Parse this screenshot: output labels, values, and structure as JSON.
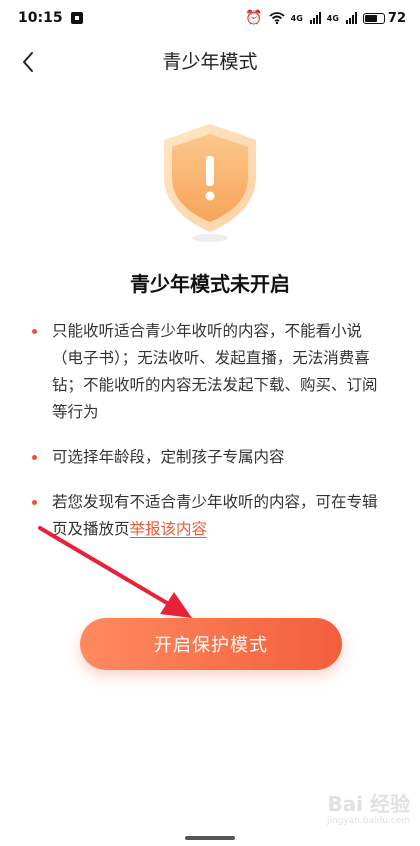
{
  "status_bar": {
    "time": "10:15",
    "battery": "72",
    "battery_level": 0.72,
    "signal_label_1": "4G",
    "signal_label_2": "4G"
  },
  "header": {
    "title": "青少年模式",
    "back_icon": "chevron-left-icon"
  },
  "main": {
    "illustration_icon": "shield-exclamation-icon",
    "status_title": "青少年模式未开启",
    "items": [
      {
        "text": "只能收听适合青少年收听的内容，不能看小说（电子书）；无法收听、发起直播，无法消费喜钻；不能收听的内容无法发起下载、购买、订阅等行为"
      },
      {
        "text": "可选择年龄段，定制孩子专属内容"
      },
      {
        "text": "若您发现有不适合青少年收听的内容，可在专辑页及播放页",
        "link": "举报该内容"
      }
    ],
    "enable_button_label": "开启保护模式"
  },
  "watermark": {
    "text": "Bai 经验",
    "sub": "jingyan.baidu.com"
  },
  "colors": {
    "accent": "#f05a36",
    "button_start": "#ff8a5f",
    "button_end": "#f35e3d",
    "annotation_arrow": "#e8203a"
  }
}
